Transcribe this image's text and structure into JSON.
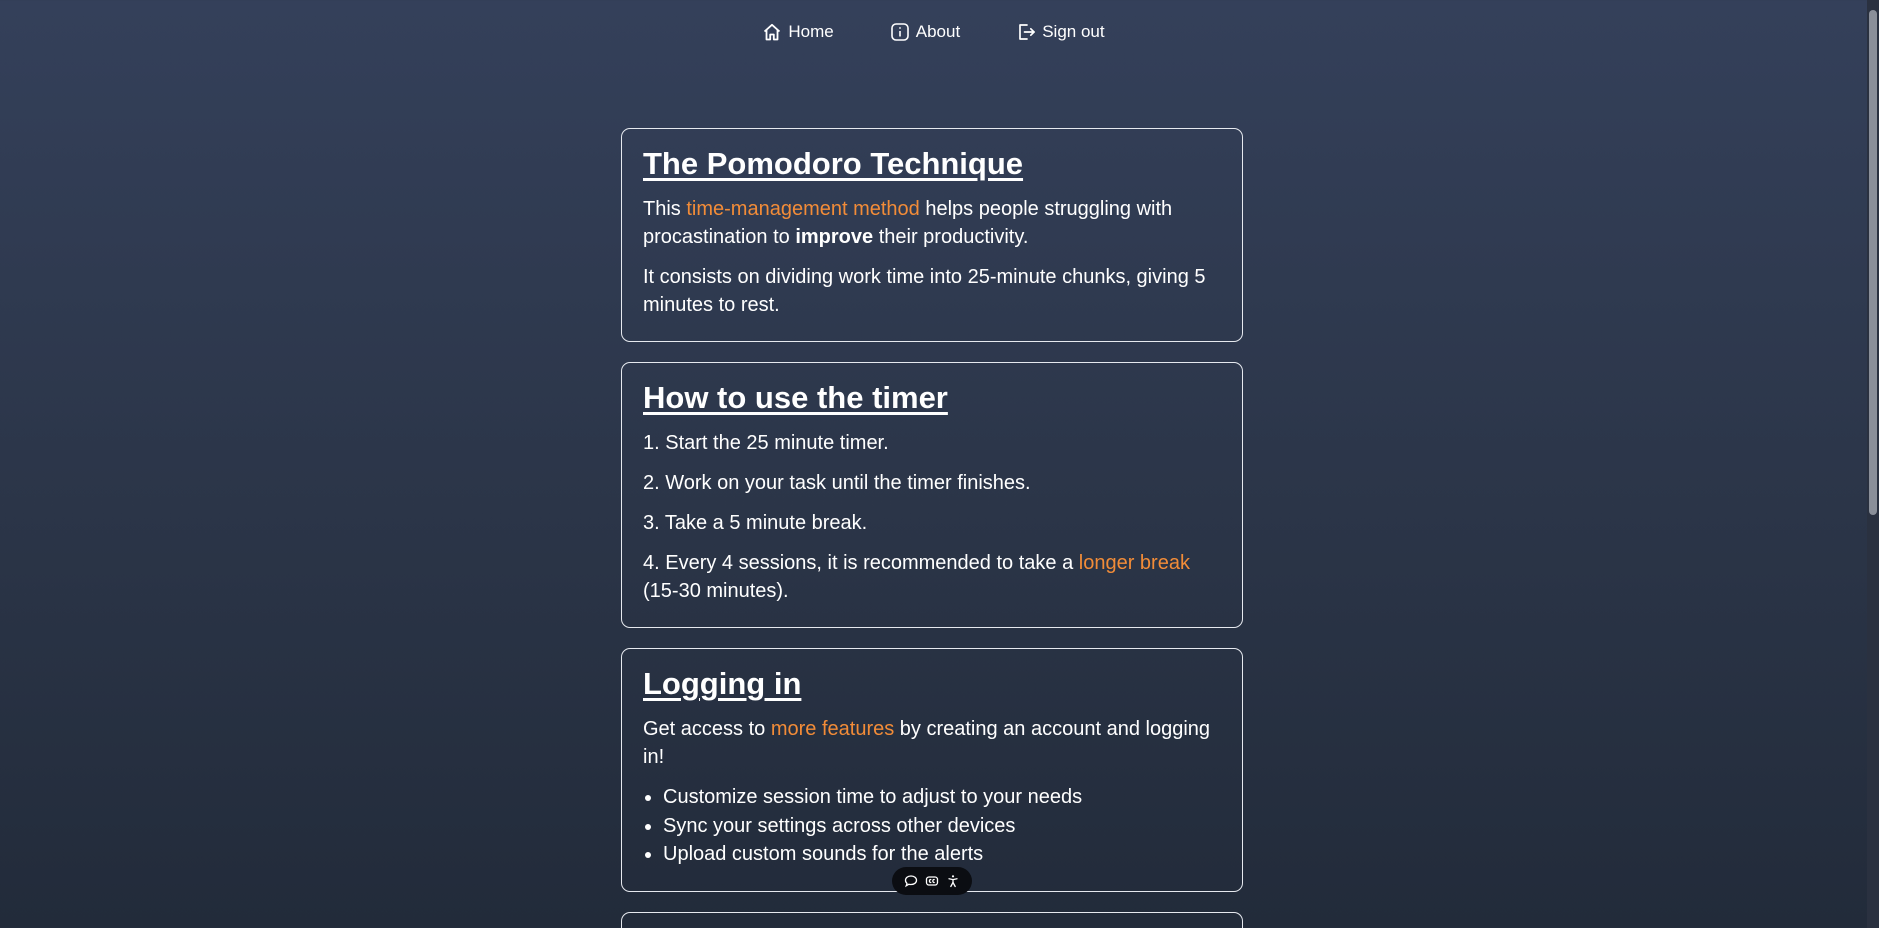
{
  "nav": {
    "home_label": "Home",
    "about_label": "About",
    "signout_label": "Sign out"
  },
  "cards": {
    "pomodoro": {
      "title": "The Pomodoro Technique",
      "p1_pre": "This ",
      "p1_link": "time-management method",
      "p1_mid": " helps people struggling with procastination to ",
      "p1_bold": "improve",
      "p1_post": " their productivity.",
      "p2": "It consists on dividing work time into 25-minute chunks, giving 5 minutes to rest."
    },
    "timer": {
      "title": "How to use the timer",
      "step1": "1. Start the 25 minute timer.",
      "step2": "2. Work on your task until the timer finishes.",
      "step3": "3. Take a 5 minute break.",
      "step4_pre": "4. Every 4 sessions, it is recommended to take a ",
      "step4_link": "longer break",
      "step4_post": " (15-30 minutes)."
    },
    "login": {
      "title": "Logging in",
      "intro_pre": "Get access to ",
      "intro_link": "more features",
      "intro_post": " by creating an account and logging in!",
      "features": [
        "Customize session time to adjust to your needs",
        "Sync your settings across other devices",
        "Upload custom sounds for the alerts"
      ]
    }
  },
  "toolbar": {
    "icons": [
      "chat-bubble-icon",
      "caption-icon",
      "accessibility-icon"
    ]
  },
  "colors": {
    "accent": "#f28c38",
    "background_top": "#34405a",
    "background_bottom": "#222b3a",
    "card_border": "#e6e9ef"
  }
}
